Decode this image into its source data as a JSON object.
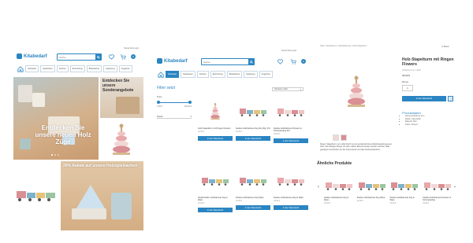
{
  "panel1": {
    "logo": "Kitabedarf",
    "search_placeholder": "Suche",
    "lang": "Sprache/Login",
    "cart_count": "0",
    "nav": [
      "Startseite",
      "Spielwaren",
      "Fahrten",
      "Einrichtung",
      "Bettwäsche",
      "Spielzeug",
      "Angebote"
    ],
    "hero_text": "Entdecken Sie unsere neuen Holz Züge",
    "side_banner_text": "Entdecken Sie unsere Sonderangebote",
    "sale_text": "20% Rabatt auf unsere Holzspielsachen"
  },
  "panel2": {
    "logo": "Kitabedarf",
    "search_placeholder": "Suche",
    "lang": "Sprache/Login",
    "cart_count": "0",
    "nav": [
      "Startseite",
      "Spielwaren",
      "Fahrten",
      "Einrichtung",
      "Bettwäsche",
      "Spielzeug",
      "Angebote"
    ],
    "filter_title": "Filter setzt",
    "filter_price_label": "Preis",
    "filter_min": "0,00 €",
    "filter_max": "100,00 €",
    "filter_select": "Marke",
    "sort_label": "Sortieren nach",
    "products": [
      {
        "title": "Holz-Stapelturm mit Ringen Flowers",
        "price": "39,99 €",
        "img": "stack"
      },
      {
        "title": "Zauber-Holzbahnset Zug Set 3tlg. IKC",
        "price": "29,99 €",
        "img": "train"
      },
      {
        "title": "Zauber-Holzbahnset Flowers & Schmetterling IKC",
        "price": "29,99 €",
        "img": "trainpink"
      },
      {
        "title": "Zauberhafter Holzbahnset Zug & Ware",
        "price": "29,99 €",
        "img": "train"
      },
      {
        "title": "Zauber-Holzbahnset Zug Ware",
        "price": "29,99 €",
        "img": "train"
      },
      {
        "title": "Zauber-Holzbahnset Zug & Ware",
        "price": "29,99 €",
        "img": "trainpink"
      }
    ],
    "add_to_cart": "In den Warenkorb"
  },
  "panel3": {
    "breadcrumb": "Start / Spielwaren / Holzspielzeug / Holz-Stapelturm",
    "close": "X Back",
    "title": "Holz-Stapelturm mit Ringen Flowers",
    "sku": "Artikelnummer: 4302",
    "price": "39,99 €",
    "qty_label": "Menge",
    "qty_value": "1",
    "add_to_cart": "In den Warenkorb",
    "details_title": "Produktdaten",
    "details": [
      "Altersempfehlung: ab 1",
      "Marke: Little Dutch",
      "Material: Holz",
      "Farbe: Flowers"
    ],
    "description": "Dieser Stapelturm von Little Dutch ist ein wunderschönes Motorikspielzeug aus Holz. Die farbigen Ringe mit dem süßen Blumenmuster werden auf den Stab gestapelt und fördern so die Feinmotorik und das Farbverständnis.",
    "related_title": "Ähnliche Produkte",
    "related": [
      {
        "title": "Zauber-Holzbahnset Zug & Ware",
        "price": "29,99 €",
        "img": "trainpink"
      },
      {
        "title": "Zauber-Holzbahnset Zug Ware",
        "price": "29,99 €",
        "img": "train"
      },
      {
        "title": "Zauber-Holzbahnset Zug & Ware",
        "price": "29,99 €",
        "img": "train"
      },
      {
        "title": "Zauber-Holzbahnset Flowers & Schmetterling",
        "price": "29,99 €",
        "img": "trainpink"
      }
    ]
  },
  "colors": {
    "accent": "#2a85c2",
    "hero_bg": "#cfa27a",
    "sale_bg": "#d9b48c",
    "pink": "#e8a7a9"
  }
}
